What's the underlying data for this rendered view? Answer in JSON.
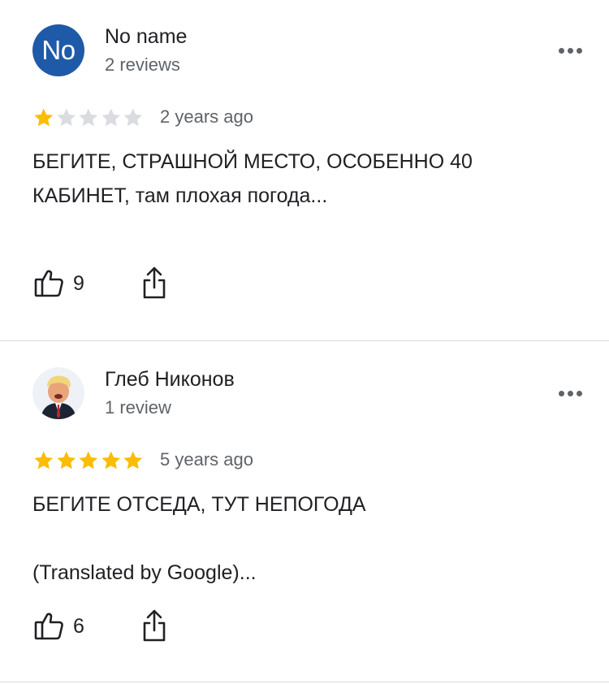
{
  "reviews": [
    {
      "author": "No name",
      "avatar_initials": "No",
      "avatar_color": "#1e5aa8",
      "review_count": "2 reviews",
      "rating": 1,
      "max_rating": 5,
      "time": "2 years ago",
      "text": "БЕГИТЕ, СТРАШНОЙ МЕСТО, ОСОБЕННО 40 КАБИНЕТ, там плохая погода...",
      "likes": "9"
    },
    {
      "author": "Глеб Никонов",
      "avatar_initials": "",
      "avatar_color": "#e9eef3",
      "review_count": "1 review",
      "rating": 5,
      "max_rating": 5,
      "time": "5 years ago",
      "text": "БЕГИТЕ ОТСЕДА, ТУТ НЕПОГОДА\n\n(Translated by Google)...",
      "likes": "6"
    }
  ],
  "colors": {
    "star_filled": "#fbbc04",
    "star_empty": "#dadce0",
    "secondary_text": "#5f6368",
    "divider": "#dadce0"
  },
  "icons": {
    "like": "thumbs-up-icon",
    "share": "share-icon",
    "more": "more-dots-icon"
  }
}
